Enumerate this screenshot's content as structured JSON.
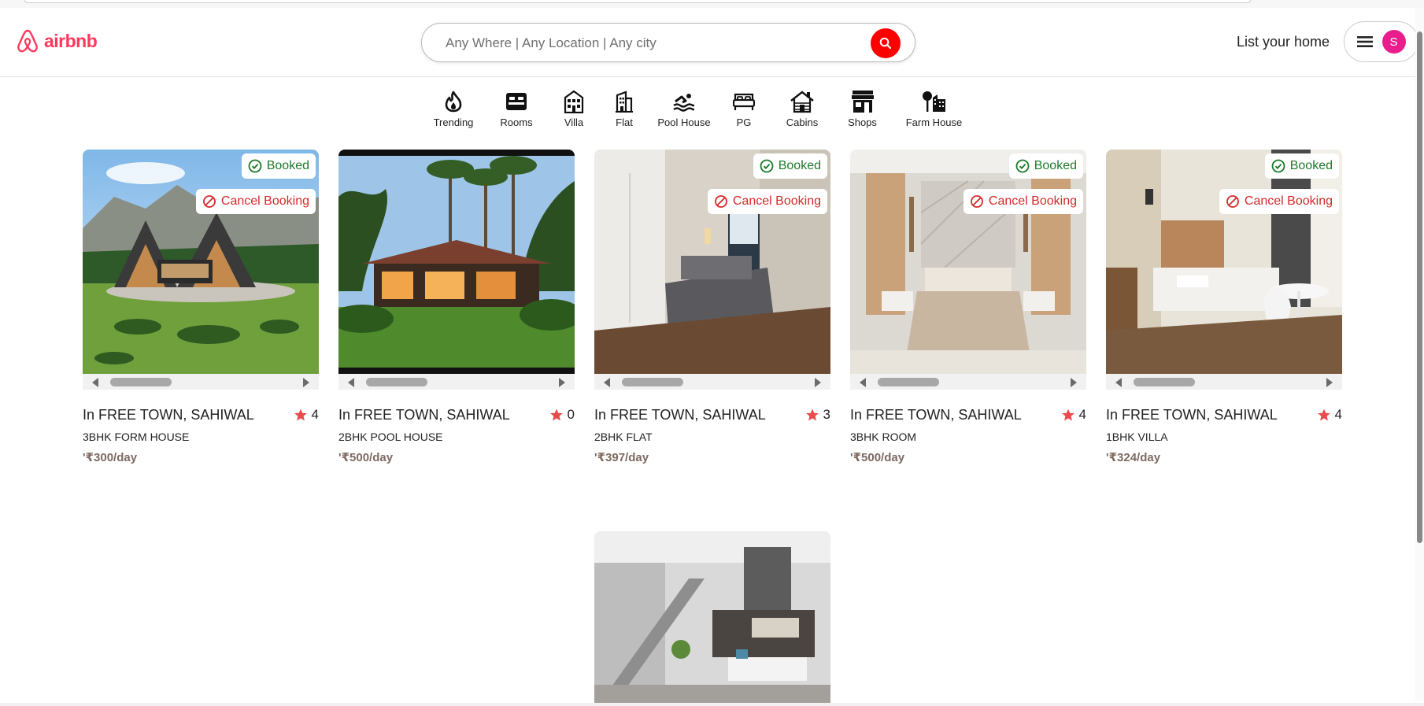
{
  "brand": {
    "name": "airbnb",
    "color": "#ff385c"
  },
  "search": {
    "placeholder": "Any Where | Any Location | Any city",
    "button_icon": "search-icon"
  },
  "header": {
    "list_home": "List your home",
    "user_initial": "S"
  },
  "categories": [
    {
      "label": "Trending",
      "icon": "fire-icon"
    },
    {
      "label": "Rooms",
      "icon": "bed-icon"
    },
    {
      "label": "Villa",
      "icon": "villa-icon"
    },
    {
      "label": "Flat",
      "icon": "building-icon"
    },
    {
      "label": "Pool House",
      "icon": "swimmer-icon"
    },
    {
      "label": "PG",
      "icon": "bed-outline-icon"
    },
    {
      "label": "Cabins",
      "icon": "cabin-icon"
    },
    {
      "label": "Shops",
      "icon": "shop-icon"
    },
    {
      "label": "Farm House",
      "icon": "farm-icon"
    }
  ],
  "listings": [
    {
      "location": "In FREE TOWN, SAHIWAL",
      "rating": "4",
      "type": "3BHK FORM HOUSE",
      "price": "'₹300/day",
      "booked": "Booked",
      "cancel": "Cancel Booking",
      "is_booked": true
    },
    {
      "location": "In FREE TOWN, SAHIWAL",
      "rating": "0",
      "type": "2BHK POOL HOUSE",
      "price": "'₹500/day",
      "is_booked": false
    },
    {
      "location": "In FREE TOWN, SAHIWAL",
      "rating": "3",
      "type": "2BHK FLAT",
      "price": "'₹397/day",
      "booked": "Booked",
      "cancel": "Cancel Booking",
      "is_booked": true
    },
    {
      "location": "In FREE TOWN, SAHIWAL",
      "rating": "4",
      "type": "3BHK ROOM",
      "price": "'₹500/day",
      "booked": "Booked",
      "cancel": "Cancel Booking",
      "is_booked": true
    },
    {
      "location": "In FREE TOWN, SAHIWAL",
      "rating": "4",
      "type": "1BHK VILLA",
      "price": "'₹324/day",
      "booked": "Booked",
      "cancel": "Cancel Booking",
      "is_booked": true
    }
  ],
  "colors": {
    "booked": "#1d7a2b",
    "cancel": "#d42a2a",
    "star": "#e84c4c",
    "search_button": "#ff0000",
    "avatar": "#e91e8c"
  }
}
